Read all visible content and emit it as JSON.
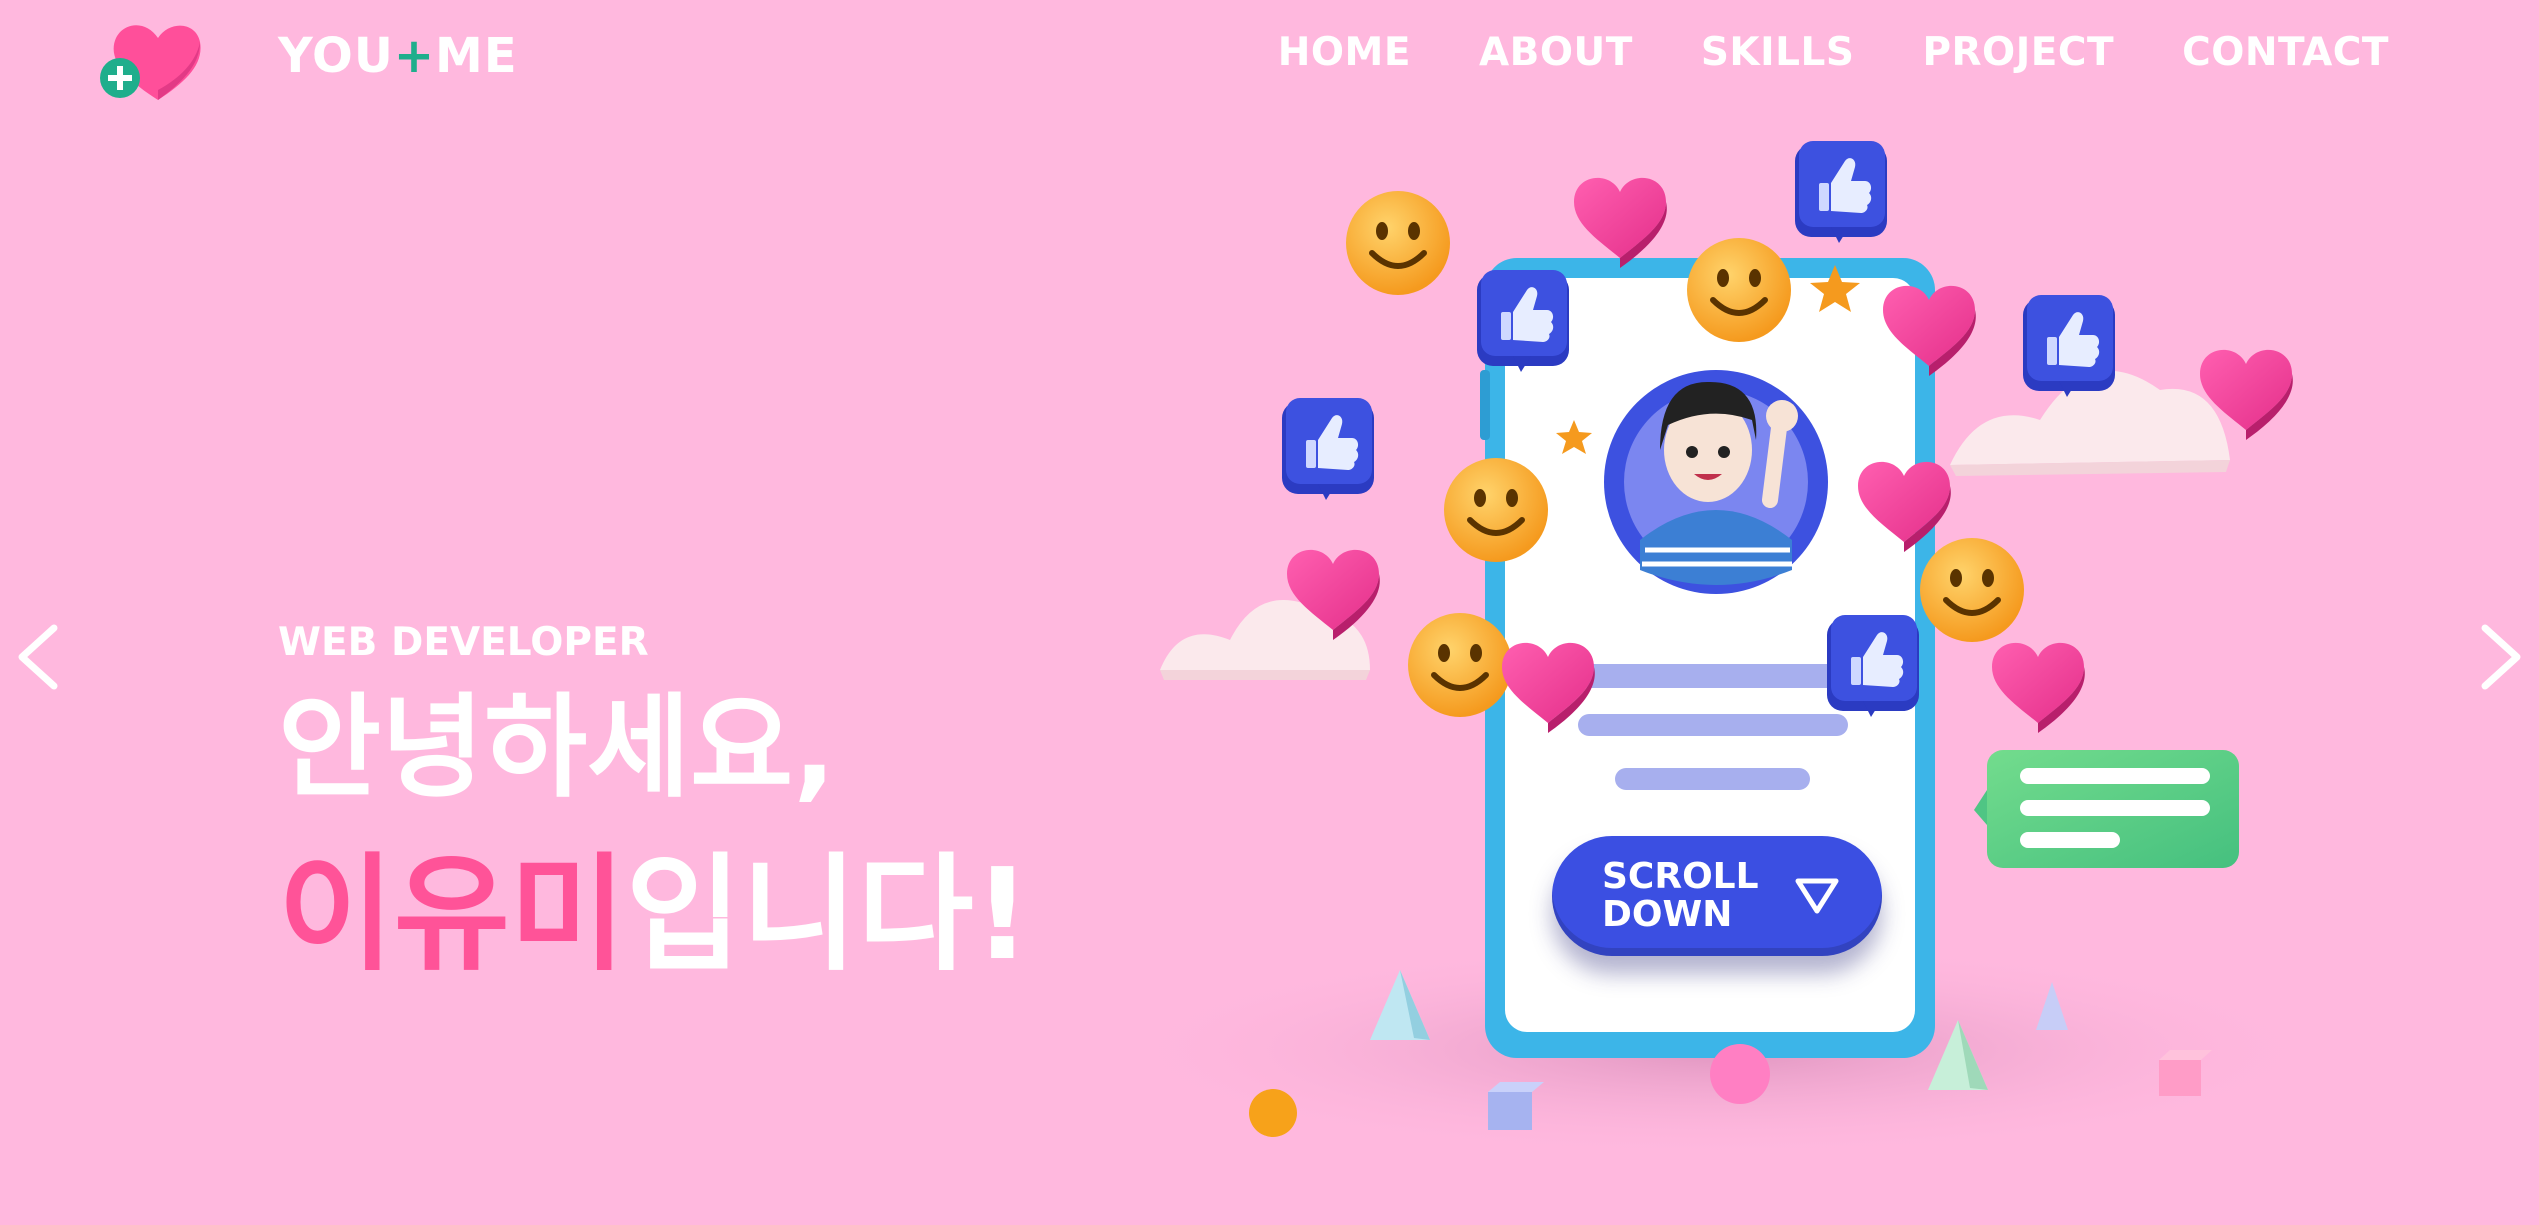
{
  "header": {
    "brand_left": "YOU",
    "brand_plus": "+",
    "brand_right": "ME",
    "nav": [
      {
        "label": "HOME"
      },
      {
        "label": "ABOUT"
      },
      {
        "label": "SKILLS"
      },
      {
        "label": "PROJECT"
      },
      {
        "label": "CONTACT"
      }
    ]
  },
  "hero": {
    "eyebrow": "WEB DEVELOPER",
    "line1": "안녕하세요,",
    "name": "이유미",
    "line2_rest": "입니다!"
  },
  "cta": {
    "line1": "SCROLL",
    "line2": "DOWN"
  },
  "colors": {
    "background": "#ffb8de",
    "accent_pink": "#ff5398",
    "button_blue": "#3b4fe2",
    "logo_green": "#1fae8c"
  },
  "icons": {
    "logo": "heart-plus-icon",
    "prev": "chevron-left-icon",
    "next": "chevron-right-icon",
    "scroll": "triangle-down-icon"
  }
}
